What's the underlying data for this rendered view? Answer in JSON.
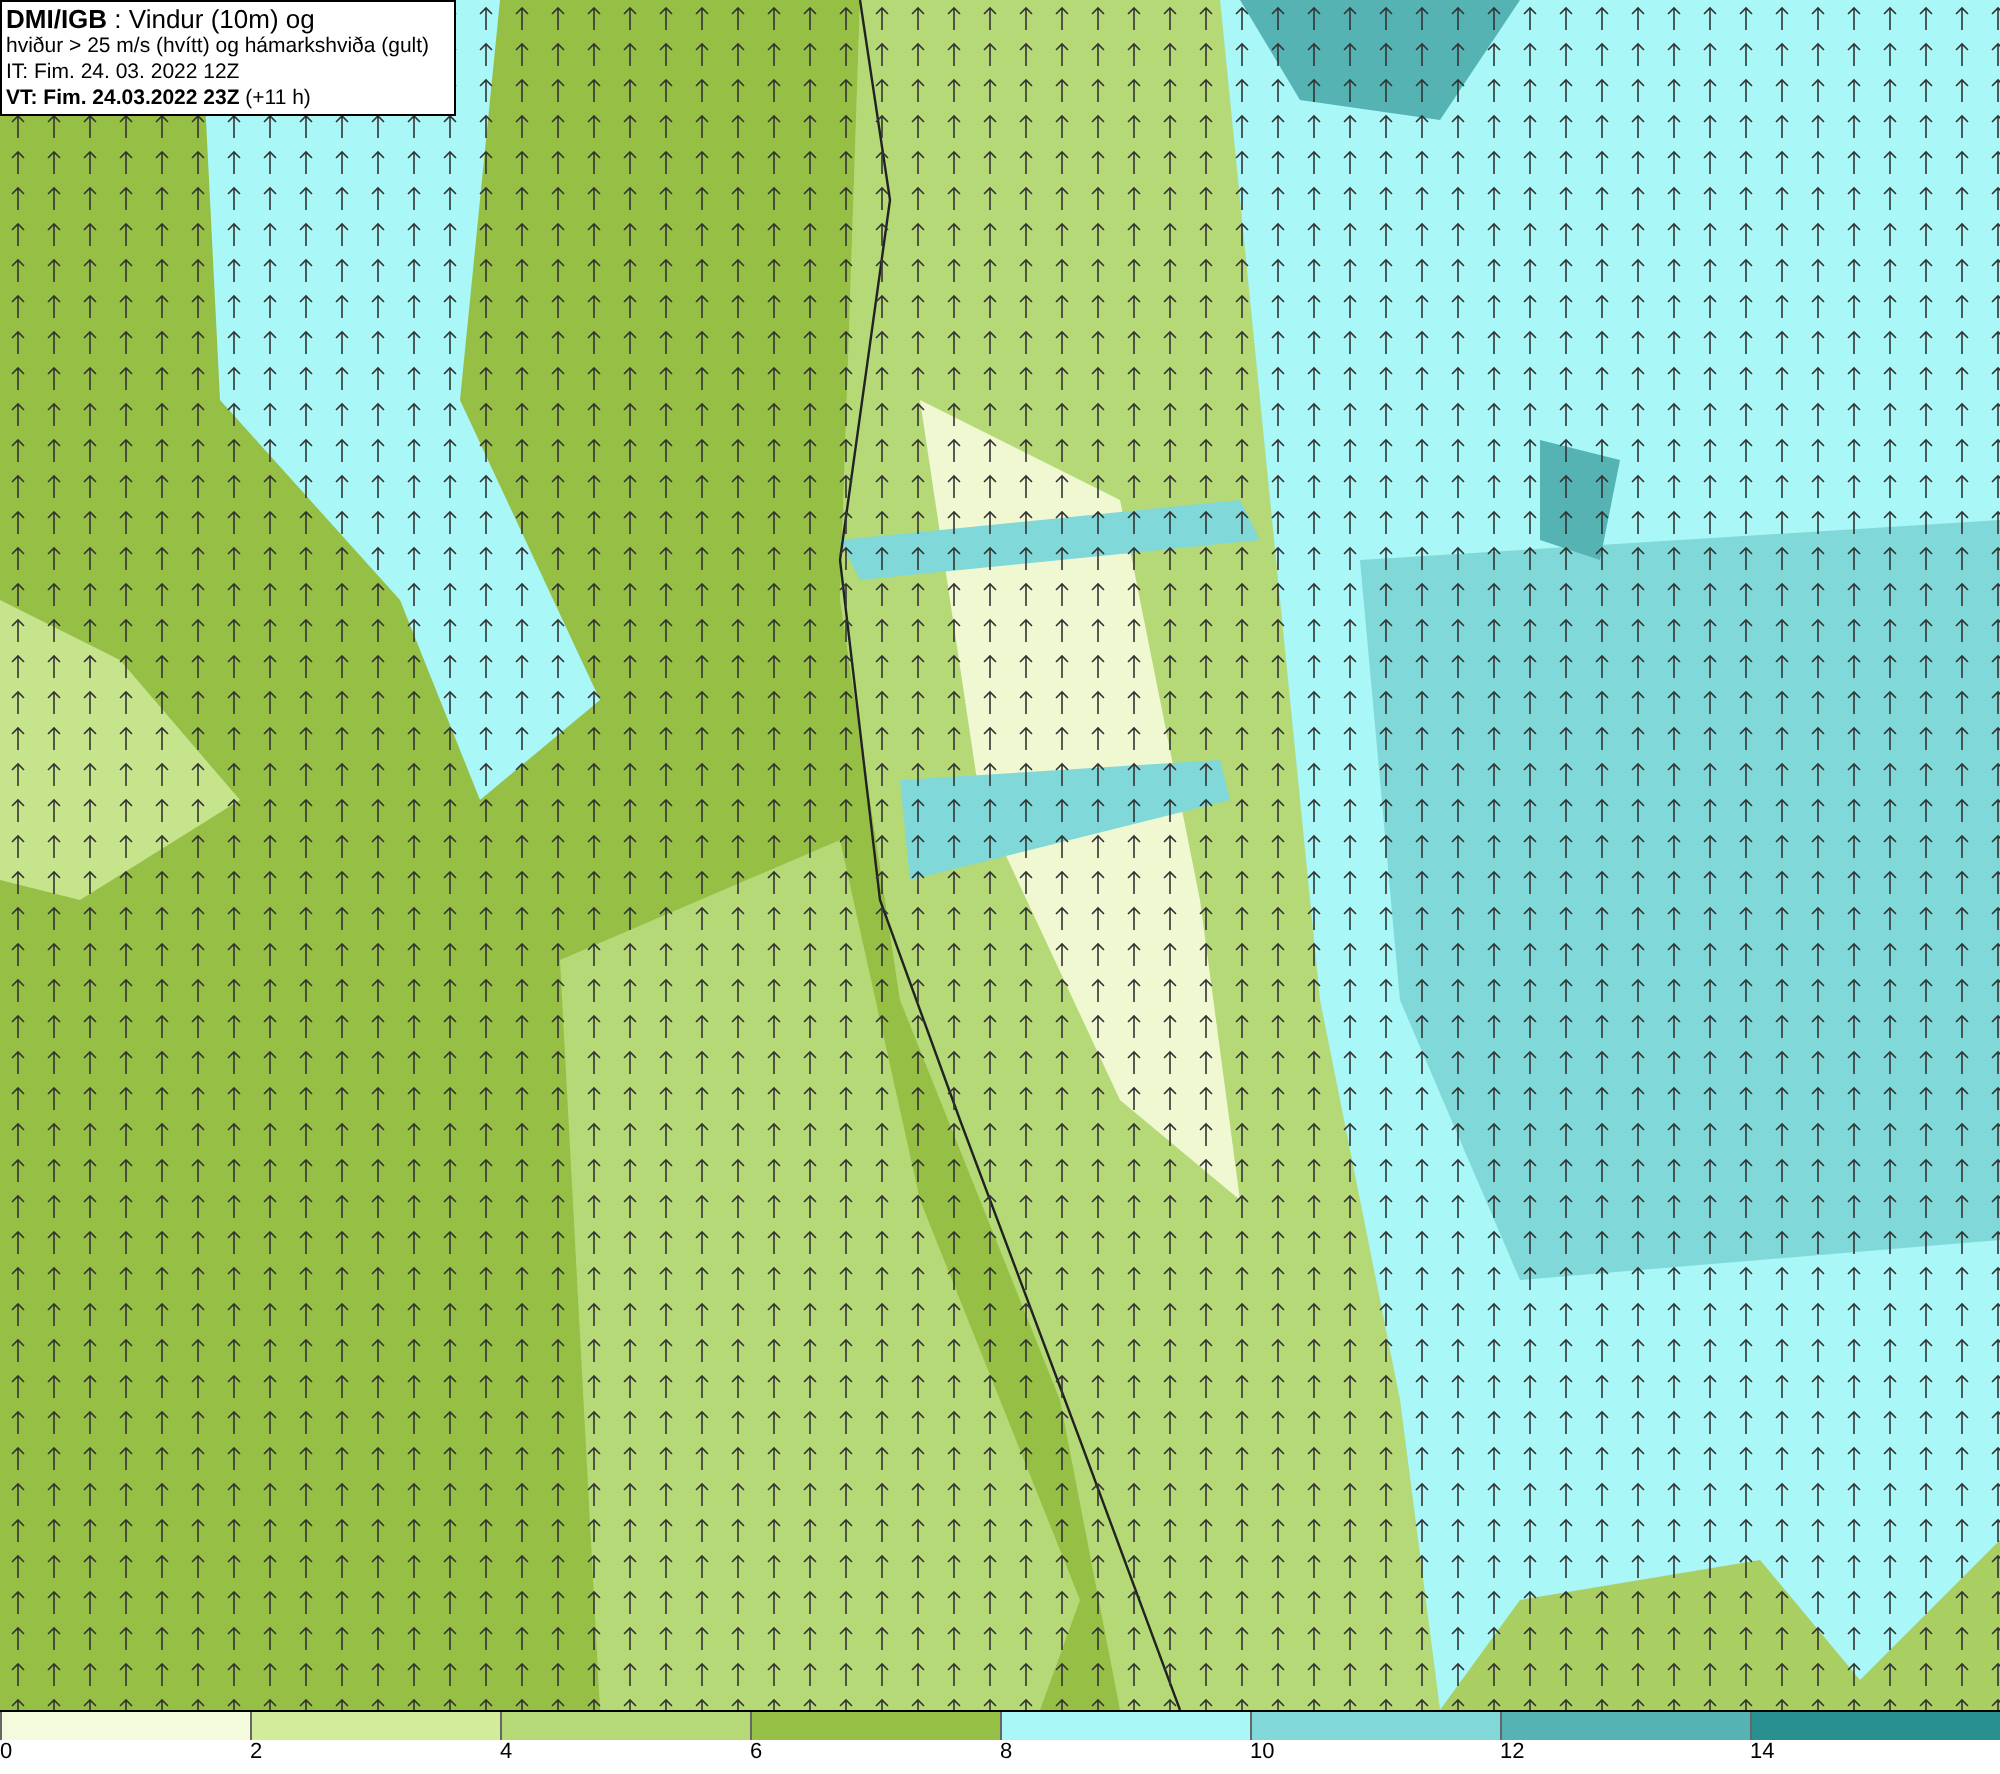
{
  "info_box": {
    "lines": [
      "**DMI/IGB** : Vindur (10m) og",
      "hviður > 25 m/s (hvítt) og hámarkshviða (gult)",
      "IT: Fim. 24. 03. 2022 12Z",
      "**VT: Fim. 24.03.2022 23Z** (+11 h)"
    ]
  },
  "legend": [
    {
      "label": "0",
      "color": "#f4fbdc"
    },
    {
      "label": "2",
      "color": "#d3ec9c"
    },
    {
      "label": "4",
      "color": "#b6d978"
    },
    {
      "label": "6",
      "color": "#95c045"
    },
    {
      "label": "8",
      "color": "#a9f7f7"
    },
    {
      "label": "10",
      "color": "#80d8d8"
    },
    {
      "label": "12",
      "color": "#55b3b3"
    },
    {
      "label": "14",
      "color": "#28918f"
    }
  ]
}
